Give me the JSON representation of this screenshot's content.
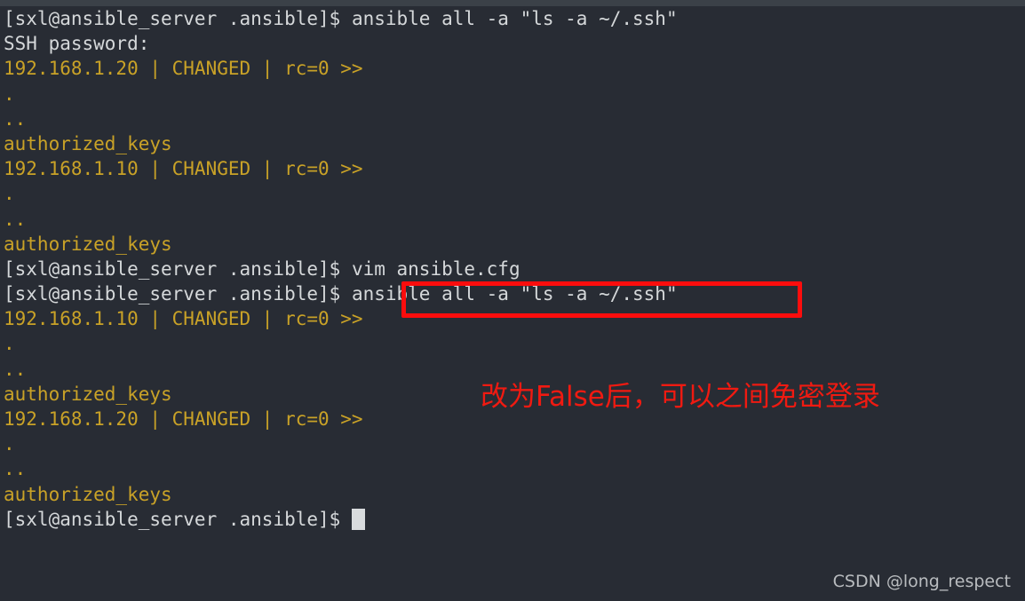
{
  "window": {
    "top_strip_color": "#3b4148",
    "background_color": "#282c34"
  },
  "terminal": {
    "prompt": "[sxl@ansible_server .ansible]$ ",
    "colors": {
      "foreground": "#d5d8da",
      "yellow": "#c9a227",
      "background": "#282c34",
      "cursor": "#d8dbdd"
    },
    "lines": [
      {
        "id": "l01",
        "prompt": "[sxl@ansible_server .ansible]$ ",
        "command": "ansible all -a \"ls -a ~/.ssh\"",
        "color": "white"
      },
      {
        "id": "l02",
        "text": "SSH password:",
        "color": "white"
      },
      {
        "id": "l03",
        "text": "192.168.1.20 | CHANGED | rc=0 >>",
        "color": "yellow"
      },
      {
        "id": "l04",
        "text": ".",
        "color": "yellow"
      },
      {
        "id": "l05",
        "text": "..",
        "color": "yellow"
      },
      {
        "id": "l06",
        "text": "authorized_keys",
        "color": "yellow"
      },
      {
        "id": "l07",
        "text": "192.168.1.10 | CHANGED | rc=0 >>",
        "color": "yellow"
      },
      {
        "id": "l08",
        "text": ".",
        "color": "yellow"
      },
      {
        "id": "l09",
        "text": "..",
        "color": "yellow"
      },
      {
        "id": "l10",
        "text": "authorized_keys",
        "color": "yellow"
      },
      {
        "id": "l11",
        "prompt": "[sxl@ansible_server .ansible]$ ",
        "command": "vim ansible.cfg",
        "color": "white"
      },
      {
        "id": "l12",
        "prompt": "[sxl@ansible_server .ansible]$ ",
        "command": "ansible all -a \"ls -a ~/.ssh\"",
        "color": "white"
      },
      {
        "id": "l13",
        "text": "192.168.1.10 | CHANGED | rc=0 >>",
        "color": "yellow"
      },
      {
        "id": "l14",
        "text": ".",
        "color": "yellow"
      },
      {
        "id": "l15",
        "text": "..",
        "color": "yellow"
      },
      {
        "id": "l16",
        "text": "authorized_keys",
        "color": "yellow"
      },
      {
        "id": "l17",
        "text": "192.168.1.20 | CHANGED | rc=0 >>",
        "color": "yellow"
      },
      {
        "id": "l18",
        "text": ".",
        "color": "yellow"
      },
      {
        "id": "l19",
        "text": "..",
        "color": "yellow"
      },
      {
        "id": "l20",
        "text": "authorized_keys",
        "color": "yellow"
      },
      {
        "id": "l21",
        "prompt": "[sxl@ansible_server .ansible]$ ",
        "command": "",
        "color": "white",
        "cursor": true
      }
    ]
  },
  "annotations": {
    "highlight_box": {
      "target_text": "ansible all -a \"ls -a ~/.ssh\"",
      "color": "#fc0d0d"
    },
    "note": {
      "text": "改为False后，可以之间免密登录",
      "color": "#f01a11"
    }
  },
  "watermark": {
    "text": "CSDN @long_respect",
    "color": "#b9bcbf"
  }
}
